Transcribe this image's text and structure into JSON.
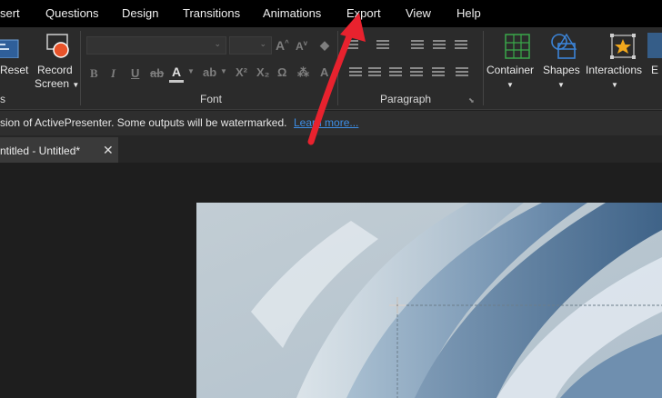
{
  "menu": {
    "items": [
      "sert",
      "Questions",
      "Design",
      "Transitions",
      "Animations",
      "Export",
      "View",
      "Help"
    ]
  },
  "ribbon": {
    "reset_label": "Reset",
    "record_label_1": "Record",
    "record_label_2": "Screen",
    "font_group": "Font",
    "paragraph_group": "Paragraph",
    "container_label": "Container",
    "shapes_label": "Shapes",
    "interactions_label": "Interactions",
    "truncated_label": "E",
    "left_group_fragment": "s"
  },
  "notice": {
    "text": "sion of ActivePresenter. Some outputs will be watermarked.",
    "link": "Learn more..."
  },
  "tabs": {
    "active": "ntitled - Untitled*",
    "close_glyph": "✕"
  },
  "colors": {
    "arrow": "#e8222e",
    "link": "#3d8ee6"
  }
}
